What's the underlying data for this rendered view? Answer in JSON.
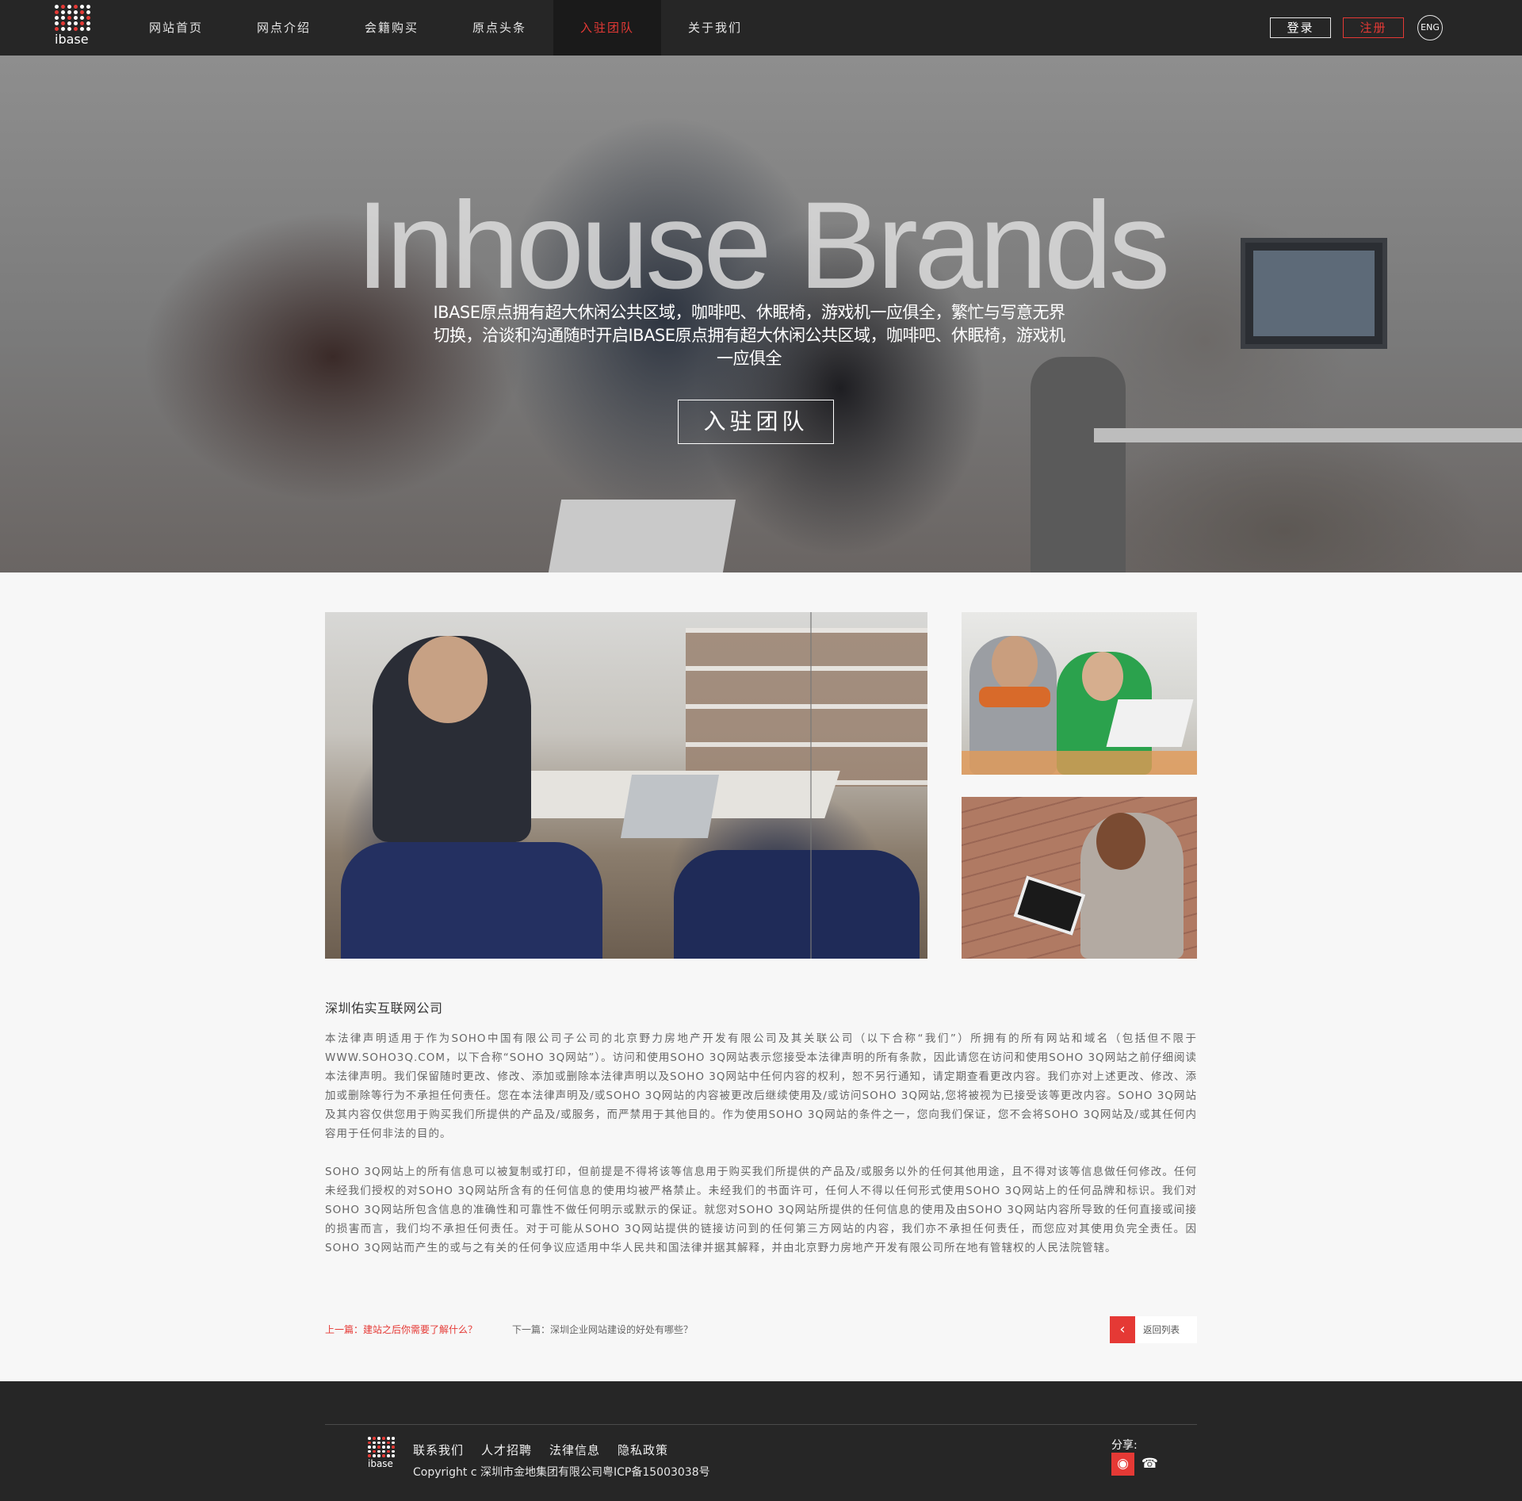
{
  "header": {
    "logo_text": "ibase",
    "nav": [
      "网站首页",
      "网点介绍",
      "会籍购买",
      "原点头条",
      "入驻团队",
      "关于我们"
    ],
    "active_nav": "入驻团队",
    "login": "登录",
    "register": "注册",
    "language": "ENG"
  },
  "hero": {
    "title": "Inhouse Brands",
    "text": "IBASE原点拥有超大休闲公共区域，咖啡吧、休眠椅，游戏机一应俱全，繁忙与写意无界切换，洽谈和沟通随时开启IBASE原点拥有超大休闲公共区域，咖啡吧、休眠椅，游戏机一应俱全",
    "button": "入驻团队"
  },
  "article": {
    "title": "深圳佑实互联网公司",
    "paragraphs": [
      "本法律声明适用于作为SOHO中国有限公司子公司的北京野力房地产开发有限公司及其关联公司（以下合称“我们”）所拥有的所有网站和域名（包括但不限于WWW.SOHO3Q.COM，以下合称“SOHO 3Q网站”）。访问和使用SOHO 3Q网站表示您接受本法律声明的所有条款，因此请您在访问和使用SOHO 3Q网站之前仔细阅读本法律声明。我们保留随时更改、修改、添加或删除本法律声明以及SOHO 3Q网站中任何内容的权利，恕不另行通知，请定期查看更改内容。我们亦对上述更改、修改、添加或删除等行为不承担任何责任。您在本法律声明及/或SOHO 3Q网站的内容被更改后继续使用及/或访问SOHO 3Q网站,您将被视为已接受该等更改内容。SOHO 3Q网站及其内容仅供您用于购买我们所提供的产品及/或服务，而严禁用于其他目的。作为使用SOHO 3Q网站的条件之一，您向我们保证，您不会将SOHO 3Q网站及/或其任何内容用于任何非法的目的。",
      "SOHO 3Q网站上的所有信息可以被复制或打印，但前提是不得将该等信息用于购买我们所提供的产品及/或服务以外的任何其他用途，且不得对该等信息做任何修改。任何未经我们授权的对SOHO 3Q网站所含有的任何信息的使用均被严格禁止。未经我们的书面许可，任何人不得以任何形式使用SOHO 3Q网站上的任何品牌和标识。我们对SOHO 3Q网站所包含信息的准确性和可靠性不做任何明示或默示的保证。就您对SOHO 3Q网站所提供的任何信息的使用及由SOHO 3Q网站内容所导致的任何直接或间接的损害而言，我们均不承担任何责任。对于可能从SOHO 3Q网站提供的链接访问到的任何第三方网站的内容，我们亦不承担任何责任，而您应对其使用负完全责任。因SOHO 3Q网站而产生的或与之有关的任何争议应适用中华人民共和国法律并据其解释，并由北京野力房地产开发有限公司所在地有管辖权的人民法院管辖。"
    ],
    "prev": "上一篇：建站之后你需要了解什么？",
    "next": "下一篇：深圳企业网站建设的好处有哪些？",
    "back": "返回列表"
  },
  "footer": {
    "logo_text": "ibase",
    "links": [
      "联系我们",
      "人才招聘",
      "法律信息",
      "隐私政策"
    ],
    "copyright": "Copyright c 深圳市金地集团有限公司粤ICP备15003038号",
    "share_label": "分享:",
    "share_icons": [
      "weibo-icon",
      "wechat-icon"
    ]
  },
  "colors": {
    "accent": "#e53935",
    "header_bg": "#262626",
    "page_bg": "#f7f7f7"
  }
}
